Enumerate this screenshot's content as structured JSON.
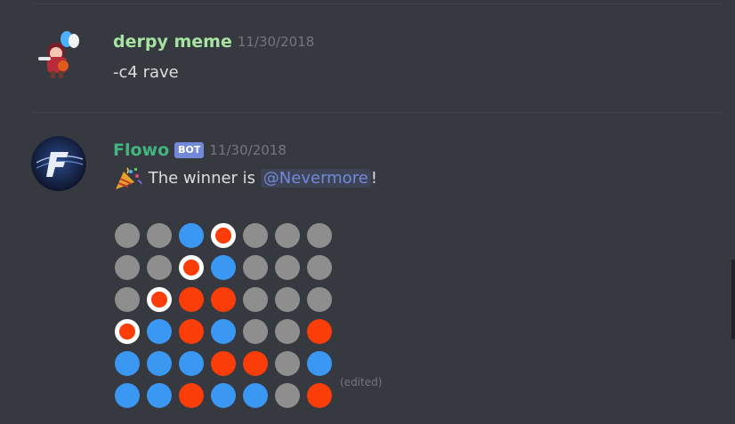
{
  "messages": [
    {
      "username": "derpy meme",
      "username_color": "#a7e3a1",
      "timestamp": "11/30/2018",
      "text": "-c4 rave"
    },
    {
      "username": "Flowo",
      "username_color": "#43b581",
      "bot_tag": "BOT",
      "timestamp": "11/30/2018",
      "emoji": "party-popper-icon",
      "text_before": "The winner is",
      "mention": "@Nevermore",
      "text_after": "!",
      "edited": "(edited)"
    }
  ],
  "board": {
    "legend": {
      "g": "empty",
      "b": "blue",
      "r": "red",
      "w": "red-winning"
    },
    "colors": {
      "empty": "#8e8e8e",
      "blue": "#3b98f2",
      "red": "#fb3d09",
      "winning_ring": "#ffffff"
    },
    "rows": [
      [
        "g",
        "g",
        "b",
        "w",
        "g",
        "g",
        "g"
      ],
      [
        "g",
        "g",
        "w",
        "b",
        "g",
        "g",
        "g"
      ],
      [
        "g",
        "w",
        "r",
        "r",
        "g",
        "g",
        "g"
      ],
      [
        "w",
        "b",
        "r",
        "b",
        "g",
        "g",
        "r"
      ],
      [
        "b",
        "b",
        "b",
        "r",
        "r",
        "g",
        "b"
      ],
      [
        "b",
        "b",
        "r",
        "b",
        "b",
        "g",
        "r"
      ]
    ]
  }
}
